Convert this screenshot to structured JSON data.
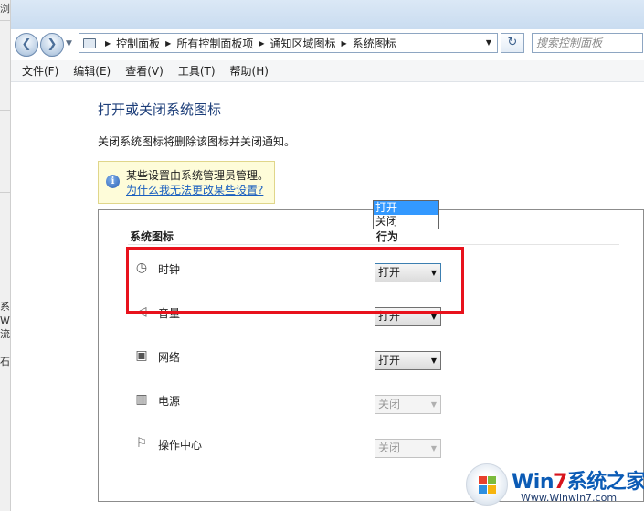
{
  "background_window": {
    "fragments": [
      "浏",
      "",
      "",
      "系",
      "W",
      "流",
      "石"
    ]
  },
  "toolbar": {
    "back_glyph": "❮",
    "forward_glyph": "❯",
    "recent_glyph": "▼",
    "address": {
      "crumbs": [
        "控制面板",
        "所有控制面板项",
        "通知区域图标",
        "系统图标"
      ],
      "separator": "▶",
      "dropdown_glyph": "▼"
    },
    "refresh_glyph": "↻",
    "search_placeholder": "搜索控制面板"
  },
  "menu": [
    "文件(F)",
    "编辑(E)",
    "查看(V)",
    "工具(T)",
    "帮助(H)"
  ],
  "main": {
    "title": "打开或关闭系统图标",
    "description": "关闭系统图标将删除该图标并关闭通知。",
    "notice": {
      "icon": "i",
      "text": "某些设置由系统管理员管理。",
      "link": "为什么我无法更改某些设置?"
    },
    "table": {
      "col_icon": "系统图标",
      "col_behavior": "行为",
      "rows": [
        {
          "icon": "clock-icon",
          "glyph": "◷",
          "name": "时钟",
          "value": "打开",
          "enabled": true
        },
        {
          "icon": "volume-icon",
          "glyph": "◁",
          "name": "音量",
          "value": "打开",
          "enabled": true
        },
        {
          "icon": "network-icon",
          "glyph": "▣",
          "name": "网络",
          "value": "打开",
          "enabled": true
        },
        {
          "icon": "power-icon",
          "glyph": "▥",
          "name": "电源",
          "value": "关闭",
          "enabled": false
        },
        {
          "icon": "action-center-icon",
          "glyph": "⚐",
          "name": "操作中心",
          "value": "关闭",
          "enabled": false
        }
      ],
      "dropdown_glyph": "▼"
    },
    "open_dropdown": {
      "options": [
        "打开",
        "关闭"
      ],
      "highlighted": "打开"
    }
  },
  "watermark": {
    "brand_w": "Wi",
    "brand_n": "n",
    "brand_7": "7",
    "brand_rest": "系统之家",
    "url": "Www.Winwin7.com"
  },
  "colors": {
    "accent_title": "#1e3f7a",
    "link": "#1a5fbf",
    "highlight_box": "#e8121c",
    "selection": "#3399ff"
  }
}
